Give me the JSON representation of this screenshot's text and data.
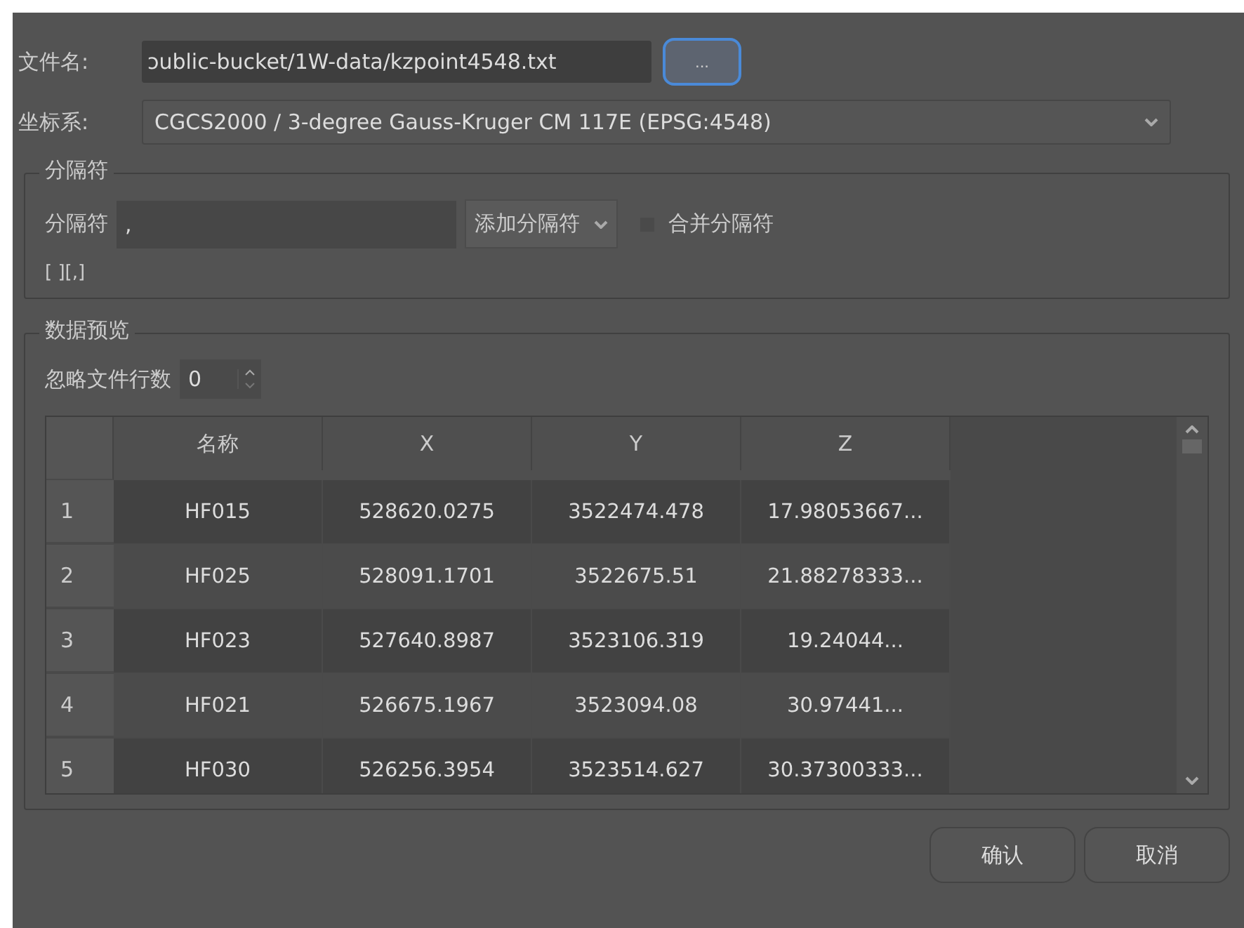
{
  "file_row": {
    "label": "文件名:",
    "value": "ɔublic-bucket/1W-data/kzpoint4548.txt",
    "browse_button": "..."
  },
  "crs_row": {
    "label": "坐标系:",
    "value": "CGCS2000 / 3-degree Gauss-Kruger CM 117E (EPSG:4548)"
  },
  "separator_group": {
    "title": "分隔符",
    "field_label": "分隔符",
    "field_value": ",",
    "add_separator": "添加分隔符",
    "merge": {
      "label": "合并分隔符",
      "checked": false
    },
    "preview": "[ ][,]"
  },
  "preview_group": {
    "title": "数据预览",
    "skip_label": "忽略文件行数",
    "skip_value": "0",
    "table": {
      "columns": [
        "名称",
        "X",
        "Y",
        "Z"
      ],
      "rows": [
        {
          "index": "1",
          "cells": [
            "HF015",
            "528620.0275",
            "3522474.478",
            "17.98053667..."
          ]
        },
        {
          "index": "2",
          "cells": [
            "HF025",
            "528091.1701",
            "3522675.51",
            "21.88278333..."
          ]
        },
        {
          "index": "3",
          "cells": [
            "HF023",
            "527640.8987",
            "3523106.319",
            "19.24044..."
          ]
        },
        {
          "index": "4",
          "cells": [
            "HF021",
            "526675.1967",
            "3523094.08",
            "30.97441..."
          ]
        },
        {
          "index": "5",
          "cells": [
            "HF030",
            "526256.3954",
            "3523514.627",
            "30.37300333..."
          ]
        }
      ]
    }
  },
  "buttons": [
    "确认",
    "取消"
  ]
}
